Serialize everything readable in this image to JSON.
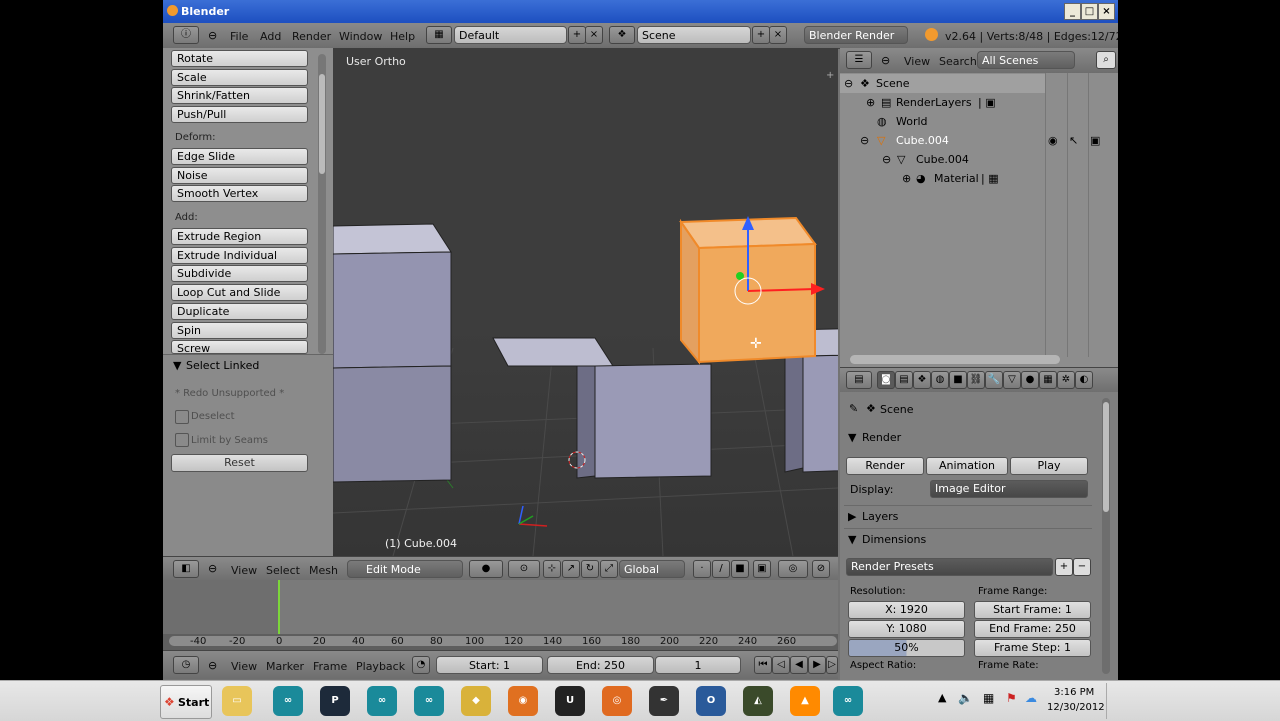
{
  "window": {
    "title": "Blender"
  },
  "topbar": {
    "menus": [
      "File",
      "Add",
      "Render",
      "Window",
      "Help"
    ],
    "screen_layout": "Default",
    "scene": "Scene",
    "engine": "Blender Render",
    "stats": "v2.64 | Verts:8/48 | Edges:12/72 | F"
  },
  "toolshelf": {
    "top_buttons": [
      "Rotate",
      "Scale",
      "Shrink/Fatten",
      "Push/Pull"
    ],
    "deform_label": "Deform:",
    "deform_buttons": [
      "Edge Slide",
      "Noise",
      "Smooth Vertex"
    ],
    "add_label": "Add:",
    "add_buttons": [
      "Extrude Region",
      "Extrude Individual",
      "Subdivide",
      "Loop Cut and Slide",
      "Duplicate",
      "Spin",
      "Screw"
    ],
    "operator_panel": "Select Linked",
    "redo_note": "* Redo Unsupported *",
    "deselect": "Deselect",
    "limit_by_seams": "Limit by Seams",
    "reset": "Reset"
  },
  "viewport": {
    "view_name": "User Ortho",
    "object_label": "(1) Cube.004"
  },
  "view3d_header": {
    "menus": [
      "View",
      "Select",
      "Mesh"
    ],
    "mode": "Edit Mode",
    "orientation": "Global"
  },
  "timeline": {
    "ticks": [
      "-40",
      "-20",
      "0",
      "20",
      "40",
      "60",
      "80",
      "100",
      "120",
      "140",
      "160",
      "180",
      "200",
      "220",
      "240",
      "260"
    ],
    "menus": [
      "View",
      "Marker",
      "Frame",
      "Playback"
    ],
    "start": "Start: 1",
    "end": "End: 250",
    "current": "1"
  },
  "outliner": {
    "menus": [
      "View",
      "Search"
    ],
    "filter": "All Scenes",
    "items": [
      "Scene",
      "RenderLayers",
      "World",
      "Cube.004",
      "Cube.004",
      "Material"
    ]
  },
  "properties": {
    "context": "Scene",
    "render_panel": "Render",
    "render_btn": "Render",
    "animation_btn": "Animation",
    "play_btn": "Play",
    "display_label": "Display:",
    "display_value": "Image Editor",
    "layers_panel": "Layers",
    "dimensions_panel": "Dimensions",
    "presets": "Render Presets",
    "resolution_label": "Resolution:",
    "res_x": "X: 1920",
    "res_y": "Y: 1080",
    "res_pct": "50%",
    "aspect_label": "Aspect Ratio:",
    "frame_range_label": "Frame Range:",
    "start_frame": "Start Frame: 1",
    "end_frame": "End Frame: 250",
    "frame_step": "Frame Step: 1",
    "frame_rate_label": "Frame Rate:"
  },
  "taskbar": {
    "start": "Start",
    "time": "3:16 PM",
    "date": "12/30/2012"
  },
  "colors": {
    "selected_orange": "#f0a95c",
    "cube_face": "#9a9ab8",
    "titlebar": "#2a5fcf"
  }
}
